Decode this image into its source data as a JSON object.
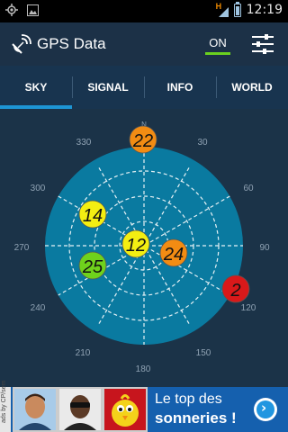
{
  "status": {
    "time": "12:19",
    "network": "H"
  },
  "app": {
    "title": "GPS Data",
    "toggle_label": "ON"
  },
  "tabs": [
    {
      "label": "SKY",
      "active": true
    },
    {
      "label": "SIGNAL",
      "active": false
    },
    {
      "label": "INFO",
      "active": false
    },
    {
      "label": "WORLD",
      "active": false
    }
  ],
  "sky": {
    "compass_north": "N",
    "azimuth_labels": [
      "30",
      "60",
      "90",
      "120",
      "150",
      "180",
      "210",
      "240",
      "270",
      "300",
      "330"
    ],
    "satellites": [
      {
        "id": "22",
        "color": "#f28c13"
      },
      {
        "id": "14",
        "color": "#f3ee12"
      },
      {
        "id": "12",
        "color": "#f3ee12"
      },
      {
        "id": "24",
        "color": "#f28c13"
      },
      {
        "id": "25",
        "color": "#6fd21c"
      },
      {
        "id": "2",
        "color": "#d8191a"
      }
    ],
    "colors": {
      "disc": "#0a7aa0",
      "background": "#1b3348",
      "grid": "#ffffff"
    }
  },
  "ad": {
    "line1": "Le top des",
    "line2": "sonneries !",
    "side_text": "ads by CP/sem",
    "background": "#1560ae"
  }
}
